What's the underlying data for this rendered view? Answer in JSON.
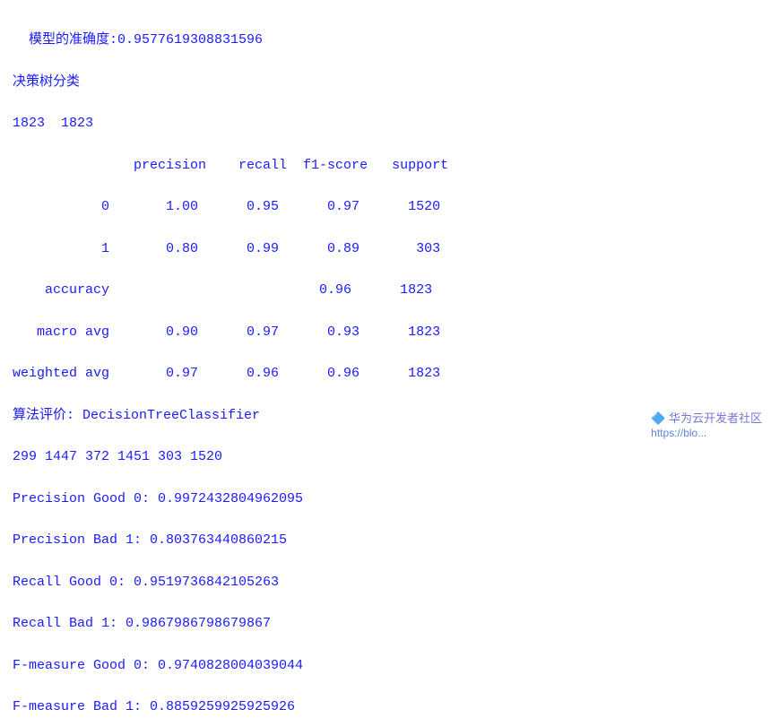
{
  "main": {
    "line1": "模型的准确度:0.9577619308831596",
    "line2": "决策树分类",
    "line3": "1823  1823",
    "table_header": "               precision    recall  f1-score   support",
    "table_row0": "\n           0       1.00      0.95      0.97      1520",
    "table_row1": "           1       0.80      0.99      0.89       303",
    "table_accuracy": "\n    accuracy                          0.96      1823",
    "table_macro": "   macro avg       0.90      0.97      0.93      1823",
    "table_weighted": "weighted avg       0.97      0.96      0.96      1823",
    "algo_header": "\n算法评价: DecisionTreeClassifier",
    "algo_counts": "299 1447 372 1451 303 1520",
    "precision_good": "\nPrecision Good 0: 0.9972432804962095",
    "precision_bad": "Precision Bad 1: 0.803763440860215",
    "recall_good": "Recall Good 0: 0.9519736842105263",
    "recall_bad": "Recall Bad 1: 0.9867986798679867",
    "fmeasure_good": "F-measure Good 0: 0.9740828004039044",
    "fmeasure_bad": "F-measure Bad 1: 0.8859259925925926"
  },
  "watermark": {
    "icon": "华为云开发者社区",
    "link": "https://blo..."
  }
}
